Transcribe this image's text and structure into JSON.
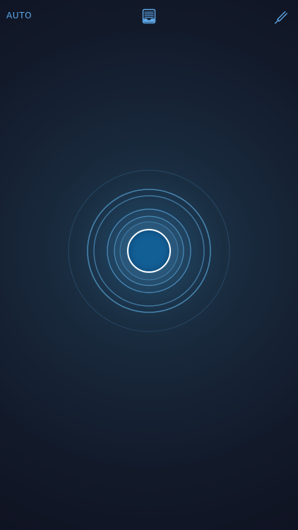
{
  "header": {
    "mode_label": "AUTO",
    "center_icon": "inbox-tray-icon",
    "right_icon": "tuning-fork-icon"
  },
  "main": {
    "widget": "sonar-rings",
    "center_button_icon": "record-button"
  },
  "colors": {
    "accent": "#5ea7e8",
    "background_top": "#1f3b52",
    "background_bottom": "#0f1322",
    "ring": "#2d6a96",
    "center_fill": "#125f96",
    "center_border": "#ffffff"
  }
}
